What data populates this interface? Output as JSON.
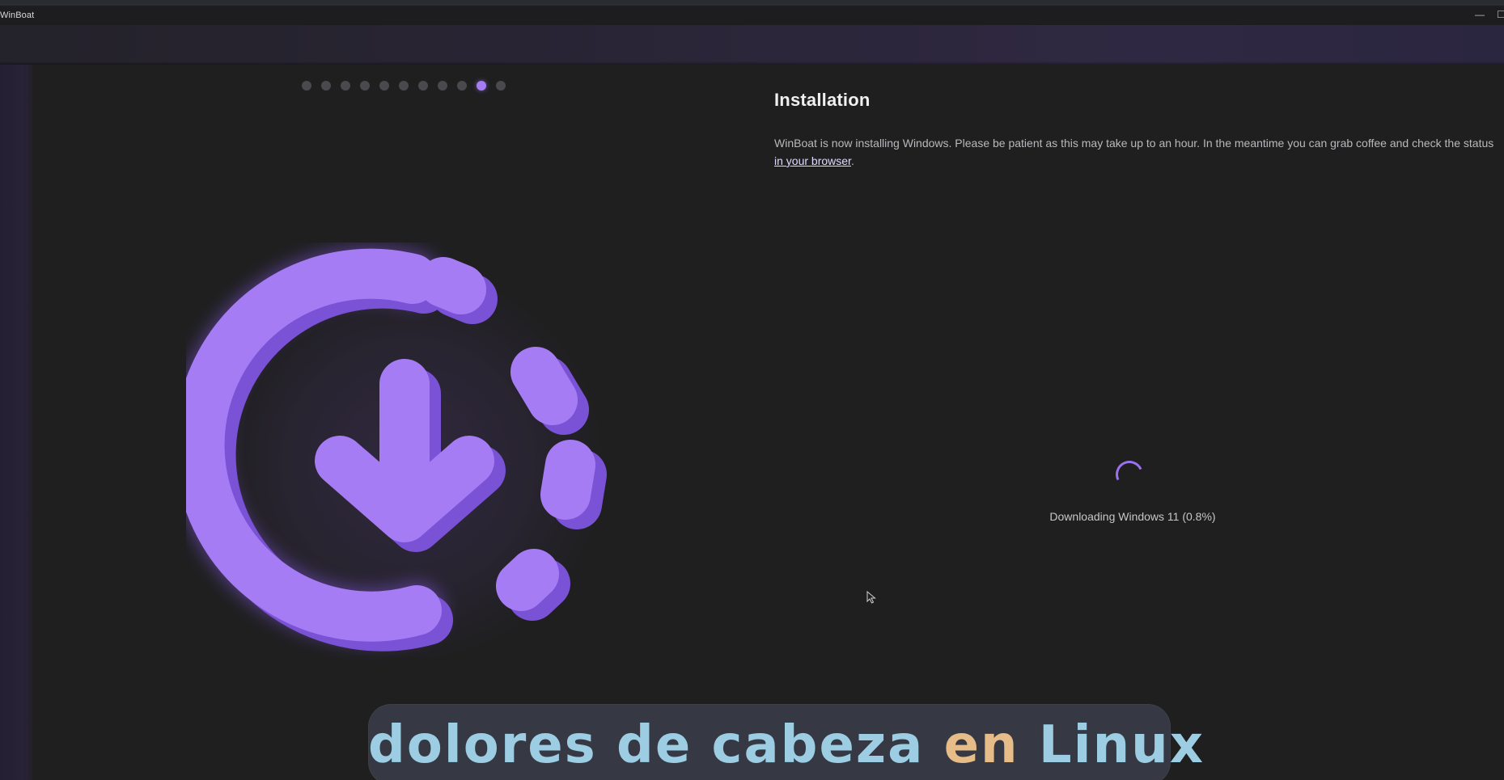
{
  "window": {
    "app_title": "WinBoat",
    "min_glyph": "—",
    "max_glyph": "☐"
  },
  "stepper": {
    "total_steps": 11,
    "active_step": 10
  },
  "hero": {
    "icon": "download-progress-icon",
    "accent_color": "#a67cf5"
  },
  "content": {
    "title": "Installation",
    "description_text": "WinBoat is now installing Windows. Please be patient as this may take up to an hour. In the meantime you can grab coffee and check the status ",
    "link_label": "in your browser",
    "description_end": ".",
    "status_text": "Downloading Windows 11 (0.8%)"
  },
  "caption": {
    "part1": "dolores de cabeza ",
    "highlight": "en",
    "part2": " Linux"
  },
  "colors": {
    "background": "#1f1f20",
    "accent": "#a67cf5",
    "caption_blue": "#9ccde3",
    "caption_orange": "#e6bd88"
  }
}
